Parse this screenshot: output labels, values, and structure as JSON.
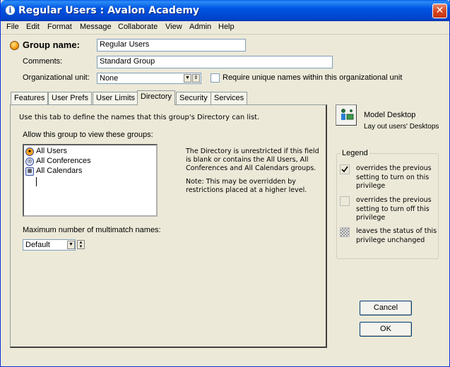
{
  "window": {
    "title": "Regular Users : Avalon Academy",
    "close_glyph": "✕"
  },
  "menu": [
    "File",
    "Edit",
    "Format",
    "Message",
    "Collaborate",
    "View",
    "Admin",
    "Help"
  ],
  "form": {
    "group_name_label": "Group name:",
    "group_name_value": "Regular Users",
    "comments_label": "Comments:",
    "comments_value": "Standard Group",
    "org_unit_label": "Organizational unit:",
    "org_unit_value": "None",
    "require_unique_label": "Require unique names within this organizational unit"
  },
  "tabs": [
    "Features",
    "User Prefs",
    "User Limits",
    "Directory",
    "Security",
    "Services"
  ],
  "active_tab": "Directory",
  "directory": {
    "intro": "Use this tab to define the names that this group's Directory can list.",
    "allow_label": "Allow this group to view these groups:",
    "groups": [
      {
        "name": "All Users",
        "icon": "group-icon"
      },
      {
        "name": "All Conferences",
        "icon": "conference-icon"
      },
      {
        "name": "All Calendars",
        "icon": "calendar-icon"
      }
    ],
    "note_lines": [
      "The Directory is unrestricted if this field",
      "is blank or contains the All Users, All",
      "Conferences and All Calendars groups."
    ],
    "note2_lines": [
      "Note: This may be overridden by",
      "restrictions placed at a higher level."
    ],
    "multimatch_label": "Maximum number of multimatch names:",
    "multimatch_value": "Default"
  },
  "model_desktop": {
    "title": "Model Desktop",
    "subtitle": "Lay out users' Desktops"
  },
  "legend": {
    "title": "Legend",
    "items": [
      {
        "state": "checked",
        "lines": [
          "overrides the previous",
          "setting to turn on this",
          "privilege"
        ]
      },
      {
        "state": "unchecked",
        "lines": [
          "overrides the previous",
          "setting to turn off this",
          "privilege"
        ]
      },
      {
        "state": "indeterminate",
        "lines": [
          "leaves the status of this",
          "privilege unchanged"
        ]
      }
    ]
  },
  "buttons": {
    "cancel": "Cancel",
    "ok": "OK"
  }
}
